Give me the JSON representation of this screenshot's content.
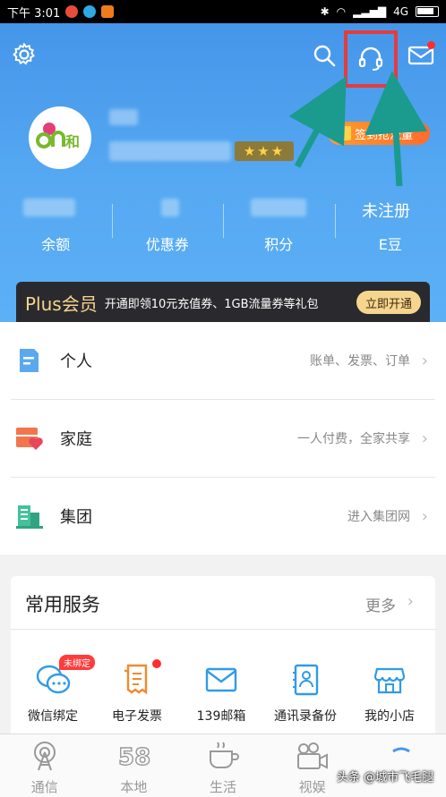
{
  "status_bar": {
    "time": "下午 3:01",
    "network": "4G"
  },
  "header": {
    "stars": "★★★",
    "signin_label": "签到抢流量",
    "unregistered": "未注册",
    "stats": [
      {
        "label": "余额"
      },
      {
        "label": "优惠券"
      },
      {
        "label": "积分"
      },
      {
        "label": "E豆"
      }
    ],
    "avatar_text": "and和"
  },
  "plus_banner": {
    "title": "Plus会员",
    "desc": "开通即领10元充值券、1GB流量券等礼包",
    "button": "立即开通"
  },
  "menu": [
    {
      "label": "个人",
      "desc": "账单、发票、订单",
      "icon": "person-doc-icon"
    },
    {
      "label": "家庭",
      "desc": "一人付费，全家共享",
      "icon": "family-icon"
    },
    {
      "label": "集团",
      "desc": "进入集团网",
      "icon": "building-icon"
    }
  ],
  "services": {
    "title": "常用服务",
    "more": "更多",
    "badge": "未绑定",
    "items": [
      {
        "label": "微信绑定",
        "icon": "wechat-bind-icon"
      },
      {
        "label": "电子发票",
        "icon": "invoice-icon"
      },
      {
        "label": "139邮箱",
        "icon": "mailbox-icon"
      },
      {
        "label": "通讯录备份",
        "icon": "contacts-backup-icon"
      },
      {
        "label": "我的小店",
        "icon": "shop-icon"
      }
    ]
  },
  "bottom_nav": [
    {
      "label": "通信"
    },
    {
      "label": "本地"
    },
    {
      "label": "生活"
    },
    {
      "label": "视娱"
    },
    {
      "label": ""
    }
  ],
  "watermark": "头条 @城市飞毛腿",
  "colors": {
    "header_blue": "#4596ea",
    "highlight_red": "#e63b3b",
    "arrow_teal": "#1b9a8e",
    "accent_orange": "#ff7a2a"
  }
}
